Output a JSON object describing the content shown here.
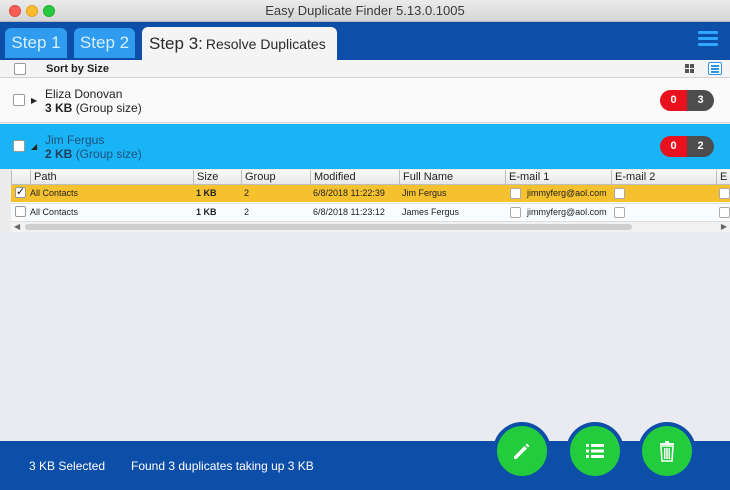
{
  "window": {
    "title": "Easy Duplicate Finder 5.13.0.1005"
  },
  "tabs": {
    "step1": "Step 1",
    "step2": "Step 2",
    "step3": "Step 3:",
    "step3_sub": "Resolve Duplicates"
  },
  "sortbar": {
    "label": "Sort by Size"
  },
  "groups": [
    {
      "name": "Eliza Donovan",
      "size": "3 KB",
      "size_note": "(Group size)",
      "count_red": "0",
      "count_total": "3",
      "expanded": false
    },
    {
      "name": "Jim Fergus",
      "size": "2 KB",
      "size_note": "(Group size)",
      "count_red": "0",
      "count_total": "2",
      "expanded": true
    }
  ],
  "table": {
    "headers": [
      "Path",
      "Size",
      "Group",
      "Modified",
      "Full Name",
      "E-mail 1",
      "E-mail 2",
      "E"
    ],
    "rows": [
      {
        "checked": true,
        "path": "All Contacts",
        "size": "1 KB",
        "group": "2",
        "modified": "6/8/2018 11:22:39",
        "full_name": "Jim Fergus",
        "email1": "jimmyferg@aol.com"
      },
      {
        "checked": false,
        "path": "All Contacts",
        "size": "1 KB",
        "group": "2",
        "modified": "6/8/2018 11:23:12",
        "full_name": "James Fergus",
        "email1": "jimmyferg@aol.com"
      }
    ]
  },
  "footer": {
    "selected": "3 KB Selected",
    "found": "Found 3 duplicates taking up 3 KB"
  },
  "colors": {
    "header_blue": "#0d4ea8",
    "tab_blue": "#2f9cf0",
    "selected_group": "#19b4f5",
    "selected_row": "#f5c12e",
    "action_green": "#22cc3d"
  },
  "icons": {
    "edit": "pencil-icon",
    "list": "list-icon",
    "delete": "trash-icon"
  }
}
